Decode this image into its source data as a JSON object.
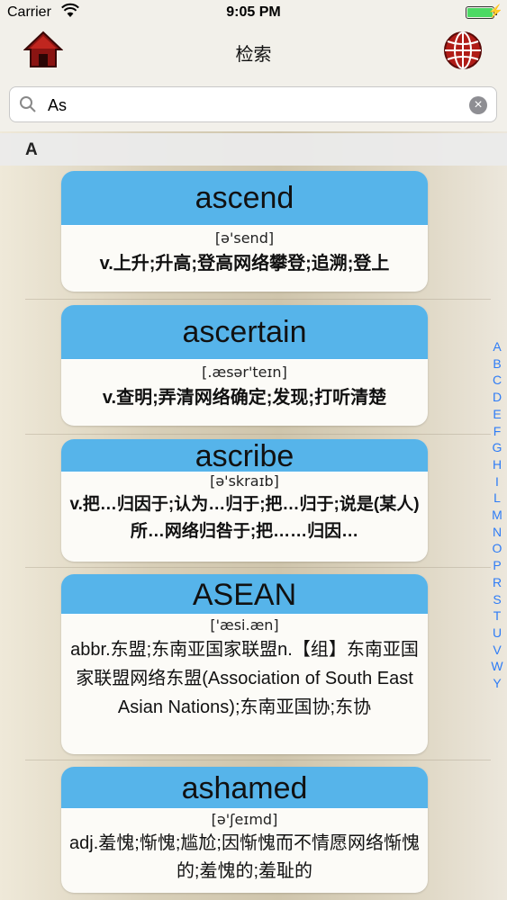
{
  "status": {
    "carrier": "Carrier",
    "time": "9:05 PM"
  },
  "nav": {
    "title": "检索"
  },
  "search": {
    "value": "As"
  },
  "section": {
    "letter": "A"
  },
  "entries": [
    {
      "word": "ascend",
      "phonetic": "[ə'send]",
      "definition": "v.上升;升高;登高网络攀登;追溯;登上"
    },
    {
      "word": "ascertain",
      "phonetic": "[.æsər'teɪn]",
      "definition": "v.查明;弄清网络确定;发现;打听清楚"
    },
    {
      "word": "ascribe",
      "phonetic": "[ə'skraɪb]",
      "definition": "v.把…归因于;认为…归于;把…归于;说是(某人)所…网络归咎于;把……归因…"
    },
    {
      "word": "ASEAN",
      "phonetic": "['æsi.æn]",
      "definition": "abbr.东盟;东南亚国家联盟n.【组】东南亚国家联盟网络东盟(Association of South East Asian Nations);东南亚国协;东协"
    },
    {
      "word": "ashamed",
      "phonetic": "[ə'ʃeɪmd]",
      "definition": "adj.羞愧;惭愧;尴尬;因惭愧而不情愿网络惭愧的;羞愧的;羞耻的"
    }
  ],
  "index_letters": [
    "A",
    "B",
    "C",
    "D",
    "E",
    "F",
    "G",
    "H",
    "I",
    "L",
    "M",
    "N",
    "O",
    "P",
    "R",
    "S",
    "T",
    "U",
    "V",
    "W",
    "Y"
  ]
}
